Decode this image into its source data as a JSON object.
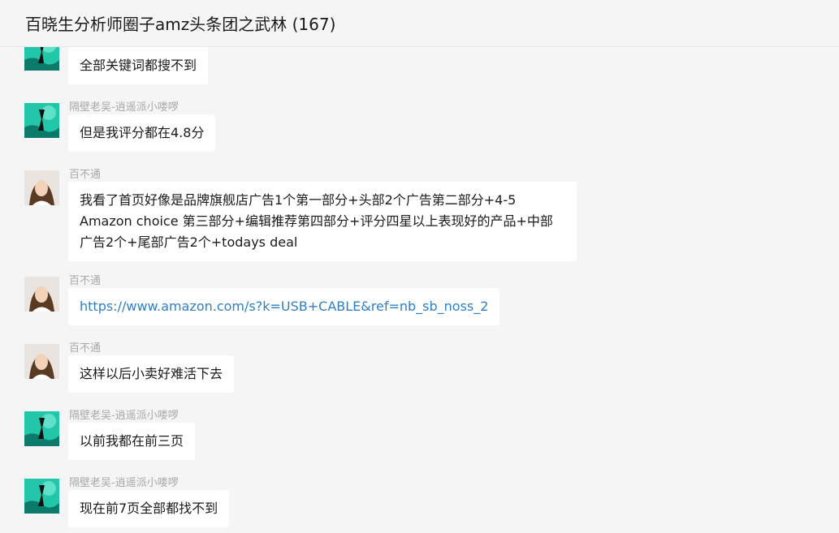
{
  "header": {
    "title": "百晓生分析师圈子amz头条团之武林 (167)"
  },
  "messages": [
    {
      "sender": "",
      "text": "全部关键词都搜不到",
      "avatar": "teal"
    },
    {
      "sender": "隔壁老吴-逍遥派小喽啰",
      "text": "但是我评分都在4.8分",
      "avatar": "teal"
    },
    {
      "sender": "百不通",
      "text": "我看了首页好像是品牌旗舰店广告1个第一部分+头部2个广告第二部分+4-5 Amazon choice 第三部分+编辑推荐第四部分+评分四星以上表现好的产品+中部广告2个+尾部广告2个+todays deal",
      "avatar": "portrait"
    },
    {
      "sender": "百不通",
      "text": "https://www.amazon.com/s?k=USB+CABLE&ref=nb_sb_noss_2",
      "avatar": "portrait"
    },
    {
      "sender": "百不通",
      "text": "这样以后小卖好难活下去",
      "avatar": "portrait"
    },
    {
      "sender": "隔壁老吴-逍遥派小喽啰",
      "text": "以前我都在前三页",
      "avatar": "teal"
    },
    {
      "sender": "隔壁老吴-逍遥派小喽啰",
      "text": "现在前7页全部都找不到",
      "avatar": "teal"
    }
  ],
  "colors": {
    "link": "#2f7fc6",
    "background": "#f5f5f5",
    "bubble": "#ffffff",
    "sender": "#a8a8a8"
  }
}
